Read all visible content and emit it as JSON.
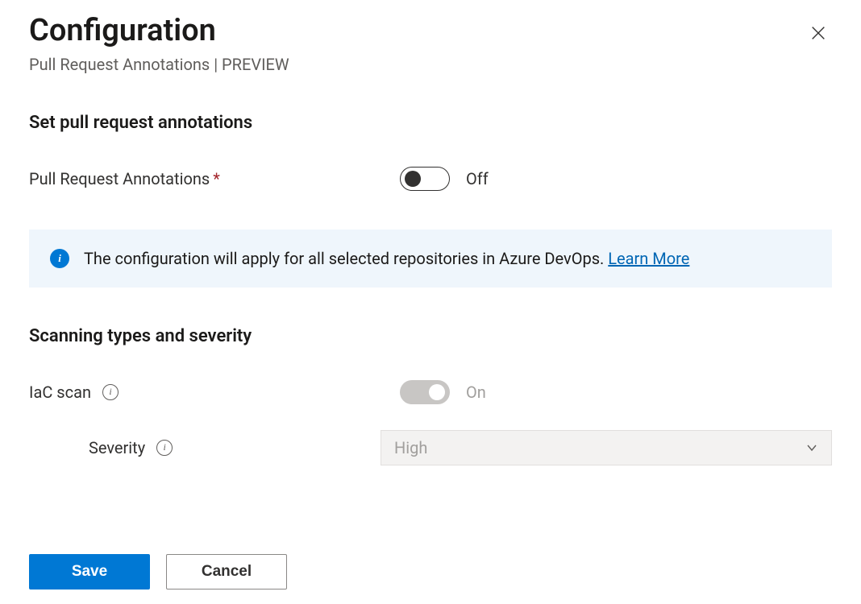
{
  "header": {
    "title": "Configuration",
    "subtitle": "Pull Request Annotations | PREVIEW"
  },
  "section_annotations": {
    "heading": "Set pull request annotations",
    "toggle_label": "Pull Request Annotations",
    "required": "*",
    "toggle_state_label": "Off"
  },
  "info_banner": {
    "text": "The configuration will apply for all selected repositories in Azure DevOps. ",
    "link_text": "Learn More"
  },
  "section_scanning": {
    "heading": "Scanning types and severity",
    "iac_label": "IaC scan",
    "iac_state_label": "On",
    "severity_label": "Severity",
    "severity_value": "High"
  },
  "footer": {
    "save": "Save",
    "cancel": "Cancel"
  }
}
